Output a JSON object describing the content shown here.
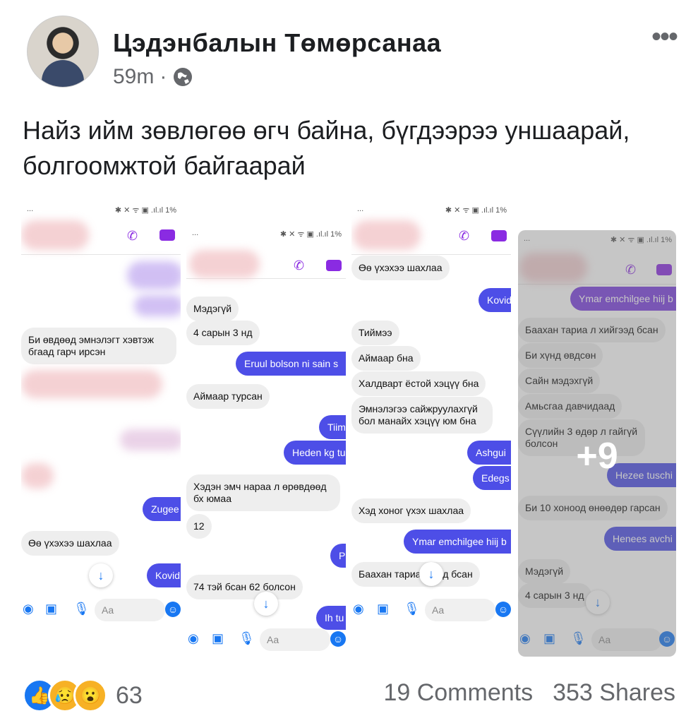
{
  "post": {
    "author": "Цэдэнбалын Төмөрсанаа",
    "time": "59m",
    "separator": "·",
    "more": "•••",
    "text": "Найз ийм зөвлөгөө өгч байна, бүгдээрээ уншаарай, болгоомжтой байгаарай"
  },
  "screens": [
    {
      "status_left": "...",
      "status_right": "✱ ✕ ᯤ ▣ .ıl.ıl 1%",
      "messages": [
        {
          "side": "in",
          "text": "Би өвдөөд эмнэлэгт хэвтэж бгаад гарч ирсэн"
        },
        {
          "side": "out",
          "text": "Zugee"
        },
        {
          "side": "in",
          "text": "Өө үхэхээ шахлаа"
        },
        {
          "side": "out",
          "text": "Kovid"
        }
      ],
      "compose_placeholder": "Aa"
    },
    {
      "status_left": "...",
      "status_right": "✱ ✕ ᯤ ▣ .ıl.ıl 1%",
      "messages": [
        {
          "side": "in",
          "text": "Мэдэгүй"
        },
        {
          "side": "in",
          "text": "4 сарын 3 нд"
        },
        {
          "side": "out",
          "text": "Eruul bolson ni sain s"
        },
        {
          "side": "in",
          "text": "Аймаар турсан"
        },
        {
          "side": "out",
          "text": "Tiim"
        },
        {
          "side": "out",
          "text": "Heden kg tu"
        },
        {
          "side": "in",
          "text": "Хэдэн эмч нараа л өрөвдөөд бх юмаа"
        },
        {
          "side": "in",
          "text": "12"
        },
        {
          "side": "out",
          "text": "P"
        },
        {
          "side": "in",
          "text": "74 тэй бсан 62 болсон"
        },
        {
          "side": "out",
          "text": "Ih tu"
        }
      ],
      "compose_placeholder": "Aa"
    },
    {
      "status_left": "...",
      "status_right": "✱ ✕ ᯤ ▣ .ıl.ıl 1%",
      "messages": [
        {
          "side": "in",
          "text": "Өө үхэхээ шахлаа"
        },
        {
          "side": "out",
          "text": "Kovid"
        },
        {
          "side": "in",
          "text": "Тиймээ"
        },
        {
          "side": "in",
          "text": "Аймаар бна"
        },
        {
          "side": "in",
          "text": "Халдварт ёстой хэцүү бна"
        },
        {
          "side": "in",
          "text": "Эмнэлэгээ сайжруулахгүй бол манайх хэцүү юм бна"
        },
        {
          "side": "out",
          "text": "Ashgui"
        },
        {
          "side": "out",
          "text": "Edegs"
        },
        {
          "side": "in",
          "text": "Хэд хоног үхэх шахлаа"
        },
        {
          "side": "out",
          "text": "Ymar emchilgee hiij b"
        },
        {
          "side": "in",
          "text": "Баахан тариа    йгээд бсан"
        }
      ],
      "compose_placeholder": "Aa"
    },
    {
      "status_left": "...",
      "status_right": "✱ ✕ ᯤ ▣ .ıl.ıl 1%",
      "messages": [
        {
          "side": "out",
          "text": "Ymar emchilgee hiij b"
        },
        {
          "side": "in",
          "text": "Баахан тариа л хийгээд бсан"
        },
        {
          "side": "in",
          "text": "Би хүнд өвдсөн"
        },
        {
          "side": "in",
          "text": "Сайн мэдэхгүй"
        },
        {
          "side": "in",
          "text": "Амьсгаа давчидаад"
        },
        {
          "side": "in",
          "text": "Сүүлийн 3 өдөр л гайгүй болсон"
        },
        {
          "side": "out",
          "text": "Hezee tuschi"
        },
        {
          "side": "in",
          "text": "Би 10 хоноод өнөөдөр гарсан"
        },
        {
          "side": "out",
          "text": "Henees avchi"
        },
        {
          "side": "in",
          "text": "Мэдэгүй"
        },
        {
          "side": "in",
          "text": "4 сарын 3 нд"
        }
      ],
      "overlay_label": "+9",
      "compose_placeholder": "Aa"
    }
  ],
  "footer": {
    "reaction_count": "63",
    "comments": "19 Comments",
    "shares": "353 Shares"
  }
}
